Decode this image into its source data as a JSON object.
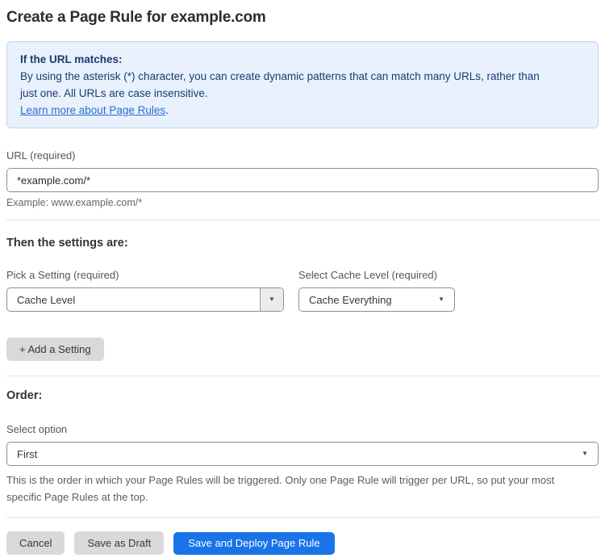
{
  "page": {
    "title": "Create a Page Rule for example.com"
  },
  "info_banner": {
    "heading": "If the URL matches:",
    "body": "By using the asterisk (*) character, you can create dynamic patterns that can match many URLs, rather than just one. All URLs are case insensitive.",
    "link_label": "Learn more about Page Rules",
    "link_suffix": "."
  },
  "url_field": {
    "label": "URL (required)",
    "value": "*example.com/*",
    "example": "Example: www.example.com/*"
  },
  "settings_section": {
    "heading": "Then the settings are:",
    "setting_picker": {
      "label": "Pick a Setting (required)",
      "value": "Cache Level"
    },
    "cache_level_picker": {
      "label": "Select Cache Level (required)",
      "value": "Cache Everything"
    },
    "add_setting_button": "+ Add a Setting"
  },
  "order_section": {
    "heading": "Order:",
    "label": "Select option",
    "value": "First",
    "help": "This is the order in which your Page Rules will be triggered. Only one Page Rule will trigger per URL, so put your most specific Page Rules at the top."
  },
  "actions": {
    "cancel": "Cancel",
    "save_draft": "Save as Draft",
    "save_deploy": "Save and Deploy Page Rule"
  },
  "icons": {
    "dropdown_arrow": "▼"
  },
  "colors": {
    "primary_button": "#1a73e8",
    "secondary_button": "#d9d9d9",
    "info_background": "#e8f1fc",
    "info_border": "#b9d6f2",
    "info_text": "#1b3b6f",
    "link": "#2c6ecb",
    "input_border": "#8f8f8f",
    "divider": "#e3e3e3"
  }
}
